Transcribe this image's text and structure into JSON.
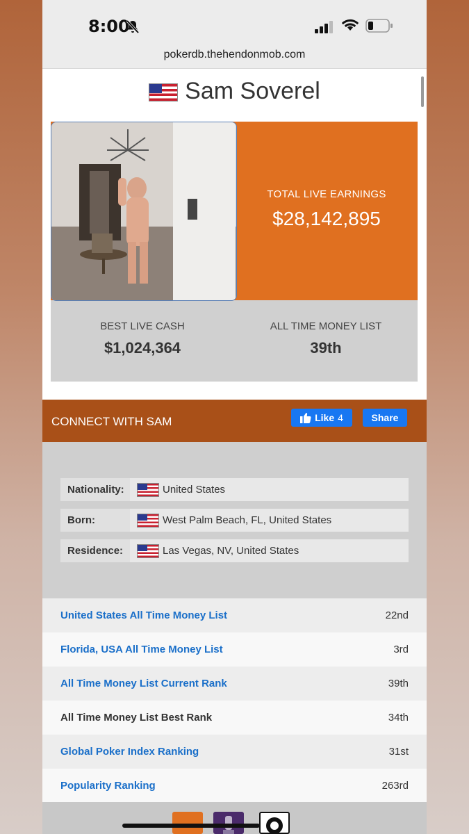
{
  "status_bar": {
    "time": "8:00"
  },
  "browser": {
    "url": "pokerdb.thehendonmob.com"
  },
  "player": {
    "name": "Sam Soverel",
    "total_live_earnings_label": "TOTAL LIVE EARNINGS",
    "total_live_earnings": "$28,142,895",
    "best_live_cash_label": "BEST LIVE CASH",
    "best_live_cash": "$1,024,364",
    "all_time_money_list_label": "ALL TIME MONEY LIST",
    "all_time_money_list": "39th"
  },
  "connect": {
    "label": "CONNECT WITH SAM",
    "like_label": "Like",
    "like_count": "4",
    "share_label": "Share"
  },
  "details": [
    {
      "label": "Nationality:",
      "value": "United States"
    },
    {
      "label": "Born:",
      "value": "West Palm Beach, FL, United States"
    },
    {
      "label": "Residence:",
      "value": "Las Vegas, NV, United States"
    }
  ],
  "rankings": [
    {
      "label": "United States All Time Money List",
      "value": "22nd"
    },
    {
      "label": "Florida, USA All Time Money List",
      "value": "3rd"
    },
    {
      "label": "All Time Money List Current Rank",
      "value": "39th"
    },
    {
      "label": "All Time Money List Best Rank",
      "value": "34th"
    },
    {
      "label": "Global Poker Index Ranking",
      "value": "31st"
    },
    {
      "label": "Popularity Ranking",
      "value": "263rd"
    }
  ],
  "colors": {
    "accent_orange": "#e07020",
    "connect_bar": "#a95018",
    "link_blue": "#1a6fc9",
    "facebook_blue": "#1877f2"
  }
}
